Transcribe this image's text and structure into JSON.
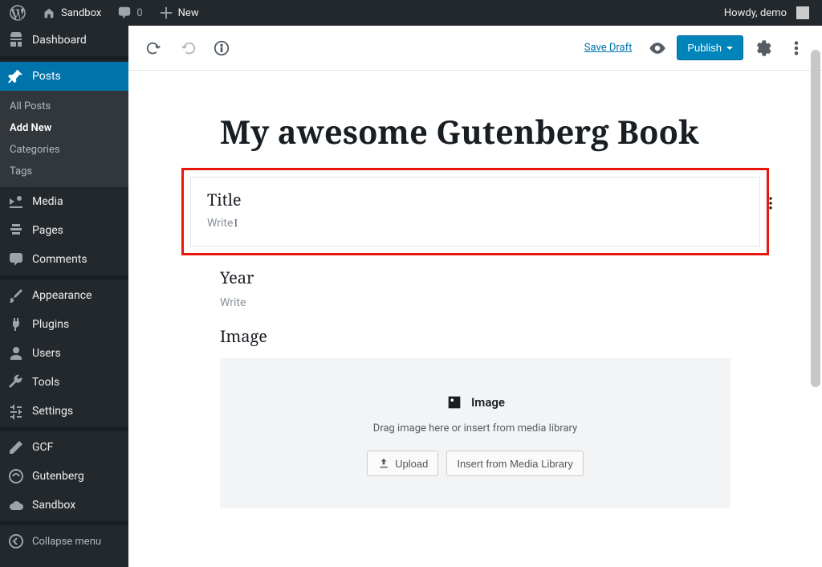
{
  "adminbar": {
    "site_name": "Sandbox",
    "comments_count": "0",
    "new_label": "New",
    "greeting": "Howdy, demo"
  },
  "sidebar": {
    "dashboard": "Dashboard",
    "posts": "Posts",
    "posts_sub": {
      "all": "All Posts",
      "add": "Add New",
      "cats": "Categories",
      "tags": "Tags"
    },
    "media": "Media",
    "pages": "Pages",
    "comments": "Comments",
    "appearance": "Appearance",
    "plugins": "Plugins",
    "users": "Users",
    "tools": "Tools",
    "settings": "Settings",
    "gcf": "GCF",
    "gutenberg": "Gutenberg",
    "sandbox": "Sandbox",
    "collapse": "Collapse menu"
  },
  "toolbar": {
    "save_draft": "Save Draft",
    "publish": "Publish"
  },
  "post": {
    "title": "My awesome Gutenberg Book",
    "title_block": {
      "label": "Title",
      "placeholder": "Write"
    },
    "year_block": {
      "label": "Year",
      "placeholder": "Write"
    },
    "image_block": {
      "section_label": "Image",
      "heading": "Image",
      "description": "Drag image here or insert from media library",
      "upload": "Upload",
      "insert": "Insert from Media Library"
    }
  }
}
